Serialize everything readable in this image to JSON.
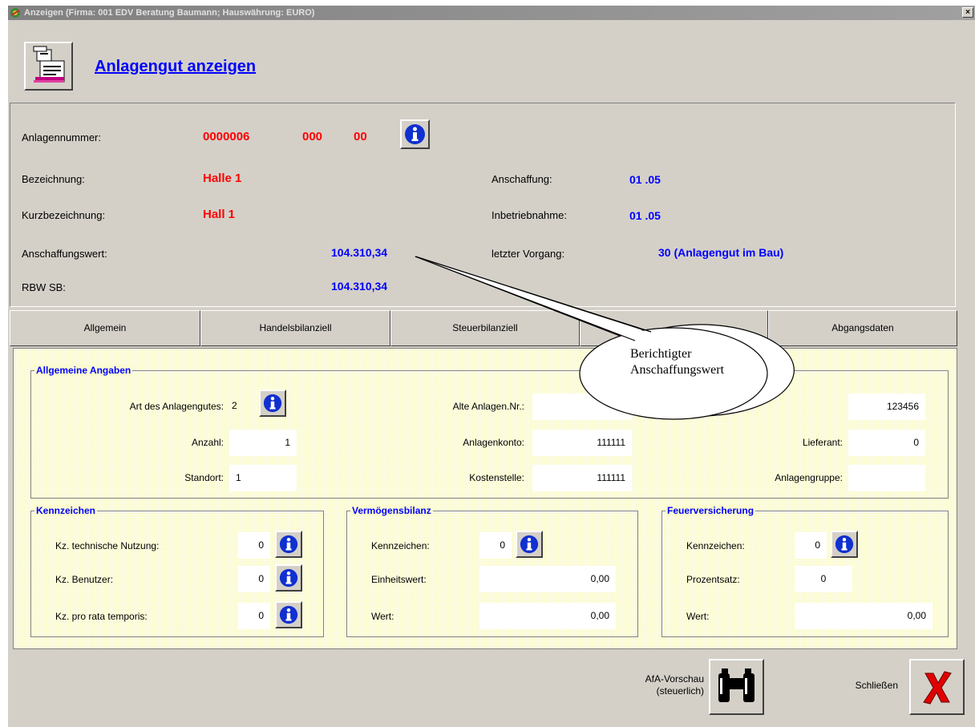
{
  "window": {
    "title": "Anzeigen  (Firma: 001 EDV Beratung Baumann;   Hauswährung: EURO)",
    "close_label": "×"
  },
  "page": {
    "title": "Anlagengut anzeigen",
    "icon": "printer-document-icon"
  },
  "header": {
    "anlagennummer_label": "Anlagennummer:",
    "anlagennummer_1": "0000006",
    "anlagennummer_2": "000",
    "anlagennummer_3": "00",
    "bezeichnung_label": "Bezeichnung:",
    "bezeichnung_value": "Halle 1",
    "kurzbezeichnung_label": "Kurzbezeichnung:",
    "kurzbezeichnung_value": "Hall 1",
    "anschaffungswert_label": "Anschaffungswert:",
    "anschaffungswert_value": "104.310,34",
    "rbw_label": "RBW SB:",
    "rbw_value": "104.310,34",
    "anschaffung_label": "Anschaffung:",
    "anschaffung_value": "01 .05",
    "inbetriebnahme_label": "Inbetriebnahme:",
    "inbetriebnahme_value": "01 .05",
    "letzter_vorgang_label": "letzter Vorgang:",
    "letzter_vorgang_value": "30  (Anlagengut im Bau)"
  },
  "tabs": [
    {
      "label": "Allgemein"
    },
    {
      "label": "Handelsbilanziell"
    },
    {
      "label": "Steuerbilanziell"
    },
    {
      "label": ""
    },
    {
      "label": "Abgangsdaten"
    }
  ],
  "allgemein": {
    "legend": "Allgemeine Angaben",
    "art_label": "Art des Anlagengutes:",
    "art_value": "2",
    "anzahl_label": "Anzahl:",
    "anzahl_value": "1",
    "standort_label": "Standort:",
    "standort_value": "1",
    "alte_nr_label": "Alte Anlagen.Nr.:",
    "alte_nr_value": "",
    "anlagenkonto_label": "Anlagenkonto:",
    "anlagenkonto_value": "111111",
    "kostenstelle_label": "Kostenstelle:",
    "kostenstelle_value": "111111",
    "hidden_field_value": "123456",
    "lieferant_label": "Lieferant:",
    "lieferant_value": "0",
    "anlagengruppe_label": "Anlagengruppe:",
    "anlagengruppe_value": ""
  },
  "kennzeichen": {
    "legend": "Kennzeichen",
    "technische_label": "Kz. technische Nutzung:",
    "technische_value": "0",
    "benutzer_label": "Kz. Benutzer:",
    "benutzer_value": "0",
    "pro_rata_label": "Kz. pro rata temporis:",
    "pro_rata_value": "0"
  },
  "vermoegensbilanz": {
    "legend": "Vermögensbilanz",
    "kennzeichen_label": "Kennzeichen:",
    "kennzeichen_value": "0",
    "einheitswert_label": "Einheitswert:",
    "einheitswert_value": "0,00",
    "wert_label": "Wert:",
    "wert_value": "0,00"
  },
  "feuerversicherung": {
    "legend": "Feuerversicherung",
    "kennzeichen_label": "Kennzeichen:",
    "kennzeichen_value": "0",
    "prozentsatz_label": "Prozentsatz:",
    "prozentsatz_value": "0",
    "wert_label": "Wert:",
    "wert_value": "0,00"
  },
  "footer": {
    "afa_line1": "AfA-Vorschau",
    "afa_line2": "(steuerlich)",
    "schliessen_label": "Schließen"
  },
  "callout": {
    "line1": "Berichtigter",
    "line2": "Anschaffungswert"
  },
  "colors": {
    "accent_blue": "#0000ff",
    "value_red": "#ff0000",
    "panel_yellow": "#fbfbd0",
    "window_gray": "#d4d0c8"
  }
}
